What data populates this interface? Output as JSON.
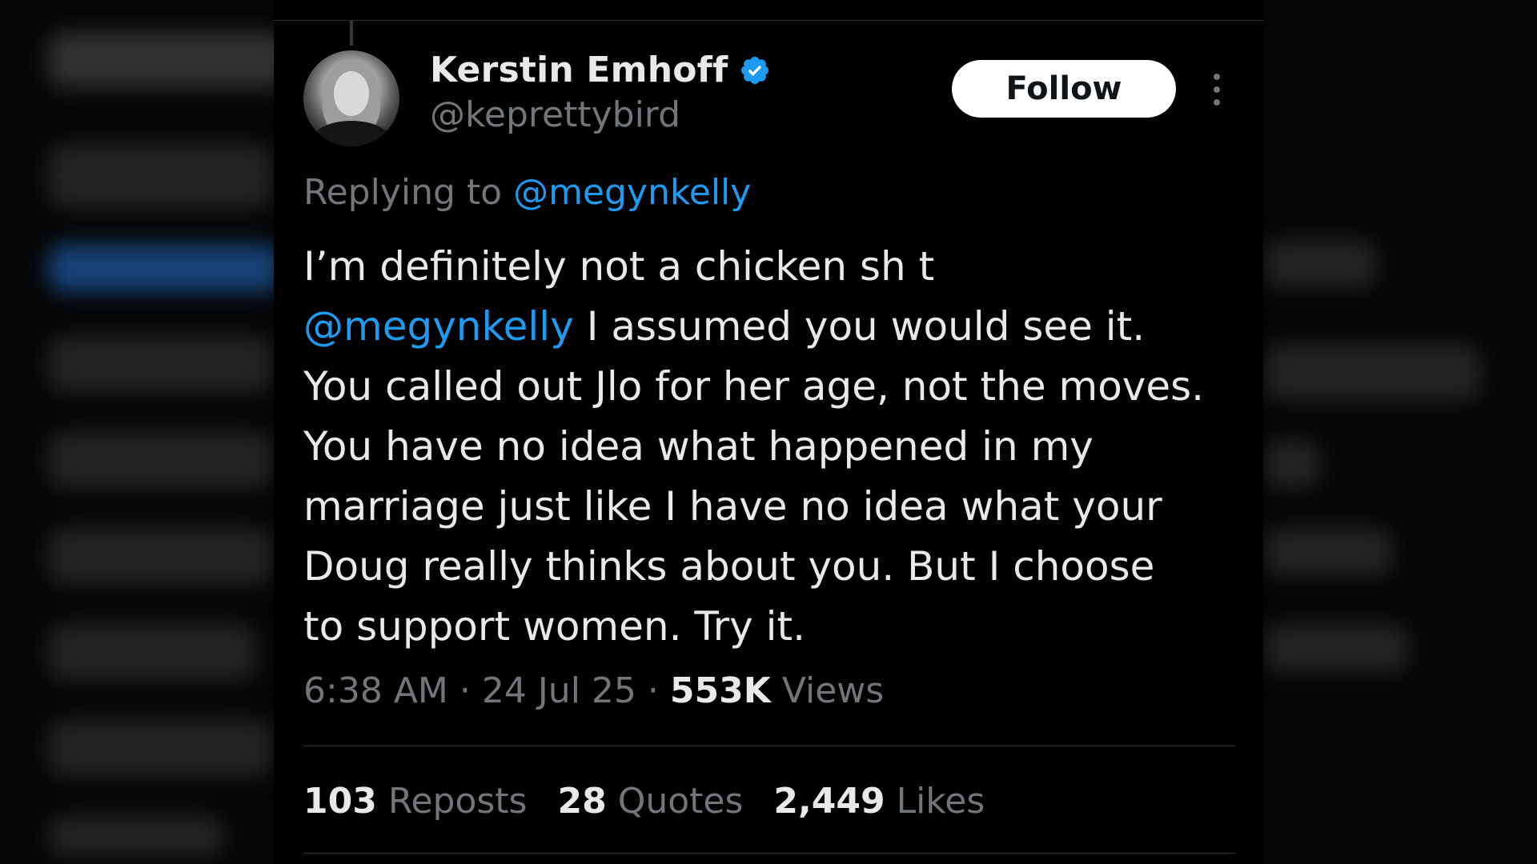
{
  "tweet": {
    "author": {
      "display_name": "Kerstin Emhoff",
      "handle": "@keprettybird",
      "verified_icon": "verified-badge-icon",
      "avatar_icon": "profile-avatar"
    },
    "follow_label": "Follow",
    "more_icon": "more-options-icon",
    "replying_prefix": "Replying to",
    "replying_to": "@megynkelly",
    "text_lines": [
      "I’m definitely not a chicken sh t",
      " I assumed you would see it.",
      "You called out Jlo for her age, not the moves.",
      "You have no idea what happened in my",
      "marriage just like I have no idea what your",
      "Doug really thinks about you. But I choose",
      "to support women. Try it."
    ],
    "inline_mention": "@megynkelly",
    "time": "6:38 AM",
    "separator": "·",
    "date": "24 Jul 25",
    "views_count": "553K",
    "views_label": "Views",
    "stats": {
      "reposts_count": "103",
      "reposts_label": "Reposts",
      "quotes_count": "28",
      "quotes_label": "Quotes",
      "likes_count": "2,449",
      "likes_label": "Likes"
    },
    "colors": {
      "accent": "#1d9bf0",
      "text": "#e7e9ea",
      "muted": "#71767b",
      "background": "#000000"
    }
  }
}
